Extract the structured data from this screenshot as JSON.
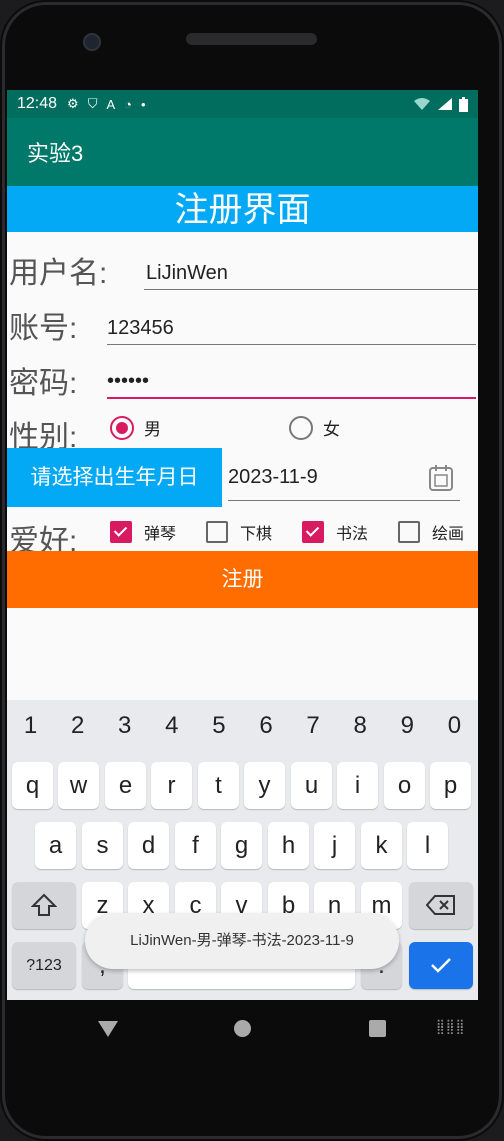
{
  "status": {
    "time": "12:48",
    "icons": [
      "gear-icon",
      "shield-icon",
      "a-icon",
      "wifi-question-icon",
      "dot-icon"
    ],
    "right_icons": [
      "wifi-x-icon",
      "signal-icon",
      "battery-icon"
    ]
  },
  "appbar": {
    "title": "实验3"
  },
  "form": {
    "header": "注册界面",
    "username_label": "用户名:",
    "username_value": "LiJinWen",
    "account_label": "账号:",
    "account_value": "123456",
    "password_label": "密码:",
    "password_value": "••••••",
    "gender_label": "性别:",
    "gender_male": "男",
    "gender_female": "女",
    "gender_selected": "男",
    "date_button": "请选择出生年月日",
    "date_value": "2023-11-9",
    "hobby_label": "爱好:",
    "hobbies": [
      {
        "label": "弹琴",
        "checked": true
      },
      {
        "label": "下棋",
        "checked": false
      },
      {
        "label": "书法",
        "checked": true
      },
      {
        "label": "绘画",
        "checked": false
      }
    ],
    "register_button": "注册"
  },
  "keyboard": {
    "numbers": [
      "1",
      "2",
      "3",
      "4",
      "5",
      "6",
      "7",
      "8",
      "9",
      "0"
    ],
    "row1": [
      "q",
      "w",
      "e",
      "r",
      "t",
      "y",
      "u",
      "i",
      "o",
      "p"
    ],
    "row2": [
      "a",
      "s",
      "d",
      "f",
      "g",
      "h",
      "j",
      "k",
      "l"
    ],
    "row3": [
      "z",
      "x",
      "c",
      "v",
      "b",
      "n",
      "m"
    ],
    "symbols_key": "?123",
    "comma_key": ",",
    "period_key": "."
  },
  "toast": {
    "text": "LiJinWen-男-弹琴-书法-2023-11-9"
  },
  "colors": {
    "appbar": "#00796b",
    "header": "#03a9f4",
    "accent": "#d81b60",
    "register": "#ff6d00",
    "enter_key": "#1a73e8"
  }
}
